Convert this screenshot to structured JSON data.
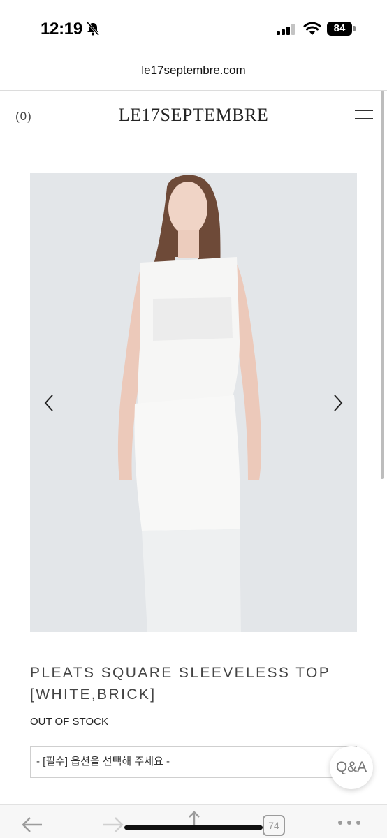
{
  "status": {
    "time": "12:19",
    "battery": "84",
    "bell_icon": "bell-slash-icon",
    "signal_icon": "cellular-signal-icon",
    "wifi_icon": "wifi-icon"
  },
  "browser": {
    "url": "le17septembre.com",
    "tab_count": "74"
  },
  "header": {
    "cart_count": "(0)",
    "logo": "LE17SEPTEMBRE",
    "menu_icon": "hamburger-menu-icon"
  },
  "product": {
    "title": "PLEATS SQUARE SLEEVELESS TOP [WHITE,BRICK]",
    "stock_status": "OUT OF STOCK",
    "option_placeholder": "- [필수] 옵션을 선택해 주세요 -",
    "qa_label": "Q&A"
  },
  "colors": {
    "image_background": "#e4e7ea",
    "text_dark": "#222222",
    "border": "#cfcfcf"
  }
}
